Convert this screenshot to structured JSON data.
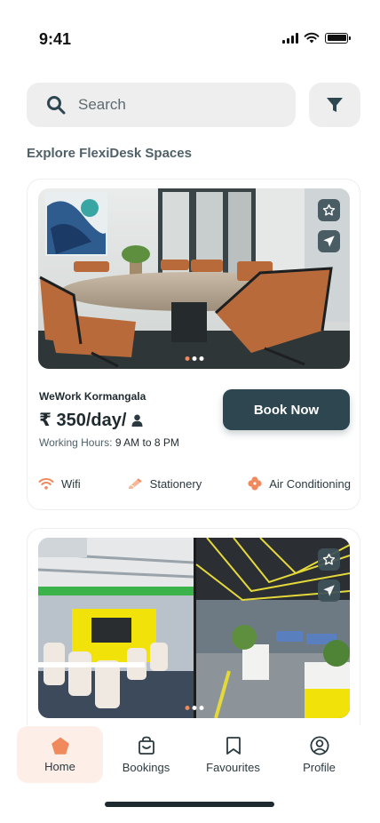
{
  "status_bar": {
    "time": "9:41"
  },
  "search": {
    "placeholder": "Search"
  },
  "section": {
    "title": "Explore FlexiDesk Spaces"
  },
  "cards": [
    {
      "name": "WeWork Kormangala",
      "price": "₹ 350/day/",
      "hours_label": "Working Hours:",
      "hours_value": "9 AM to 8 PM",
      "book_label": "Book Now",
      "image_icon": "conference-room-photo",
      "carousel": {
        "pages": 3,
        "active": 0
      },
      "amenities": [
        {
          "icon": "wifi-icon",
          "label": "Wifi"
        },
        {
          "icon": "stationery-icon",
          "label": "Stationery"
        },
        {
          "icon": "air-conditioning-icon",
          "label": "Air Conditioning"
        }
      ]
    },
    {
      "image_icon": "open-office-photo",
      "carousel": {
        "pages": 3,
        "active": 0
      }
    }
  ],
  "nav": {
    "items": [
      {
        "label": "Home",
        "icon": "home-icon",
        "active": true
      },
      {
        "label": "Bookings",
        "icon": "bookings-icon",
        "active": false
      },
      {
        "label": "Favourites",
        "icon": "bookmark-icon",
        "active": false
      },
      {
        "label": "Profile",
        "icon": "profile-icon",
        "active": false
      }
    ]
  },
  "colors": {
    "primary": "#2d4650",
    "accent": "#f08a5d",
    "nav_active_bg": "#fdeee8",
    "input_bg": "#eeeeee"
  }
}
